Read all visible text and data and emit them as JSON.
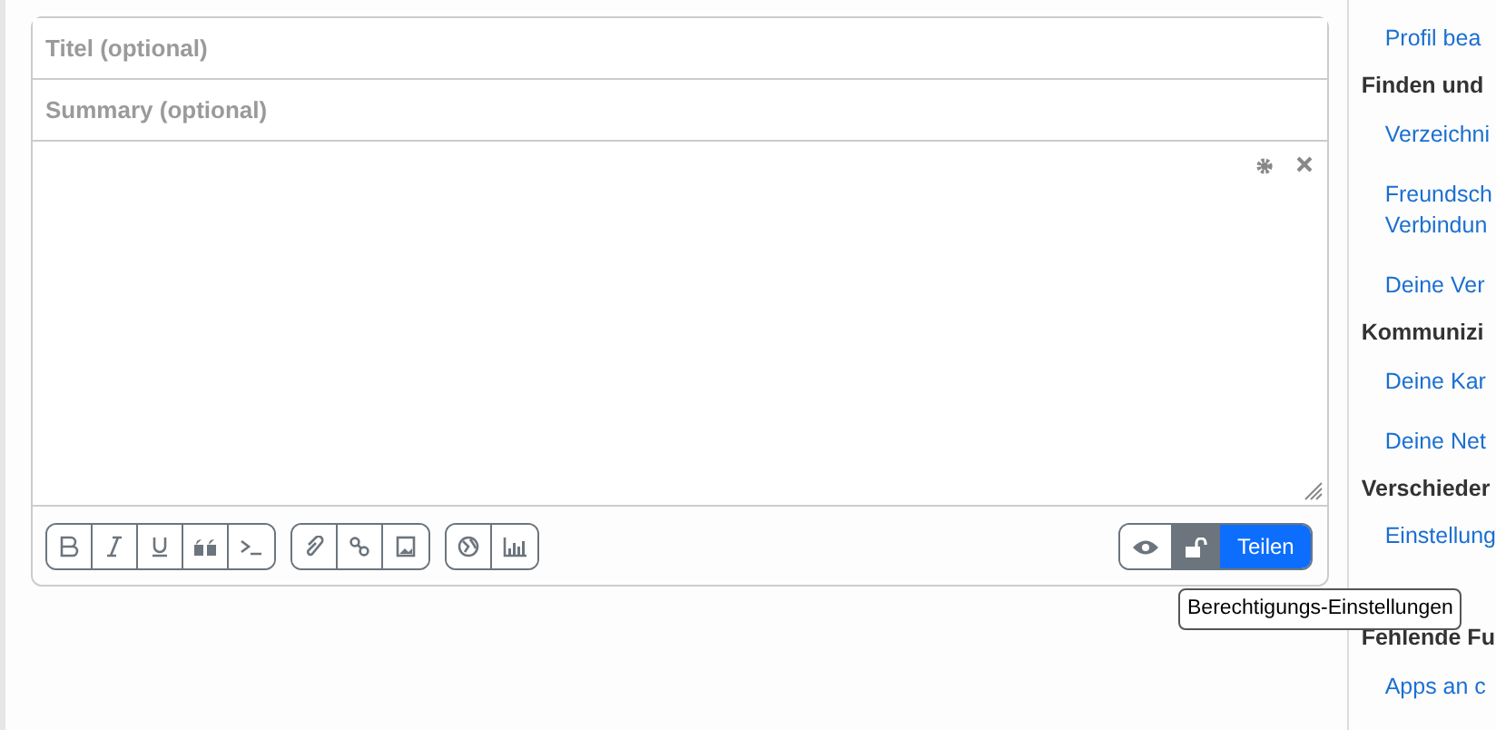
{
  "editor": {
    "title_placeholder": "Titel (optional)",
    "summary_placeholder": "Summary (optional)",
    "format_groups": [
      [
        {
          "kind": "bold"
        },
        {
          "kind": "italic"
        },
        {
          "kind": "underline"
        },
        {
          "kind": "quote"
        },
        {
          "kind": "code"
        }
      ],
      [
        {
          "kind": "attach"
        },
        {
          "kind": "link"
        },
        {
          "kind": "image"
        }
      ],
      [
        {
          "kind": "embed"
        },
        {
          "kind": "poll"
        }
      ]
    ],
    "submit": "Teilen",
    "tooltip": "Berechtigungs-Einstellungen"
  },
  "sidebar": [
    {
      "kind": "link",
      "text": "Profil bea"
    },
    {
      "kind": "heading",
      "text": "Finden und"
    },
    {
      "kind": "link",
      "text": "Verzeichni"
    },
    {
      "kind": "link",
      "text": "Freundsch\nVerbindun"
    },
    {
      "kind": "link",
      "text": "Deine Ver"
    },
    {
      "kind": "heading",
      "text": "Kommunizi"
    },
    {
      "kind": "link",
      "text": "Deine Kar"
    },
    {
      "kind": "link",
      "text": "Deine Net"
    },
    {
      "kind": "heading",
      "text": "Verschieder"
    },
    {
      "kind": "link",
      "text": "Einstellung"
    },
    {
      "kind": "gap"
    },
    {
      "kind": "heading",
      "text": "Fehlende Fu"
    },
    {
      "kind": "link",
      "text": "Apps an c"
    }
  ]
}
